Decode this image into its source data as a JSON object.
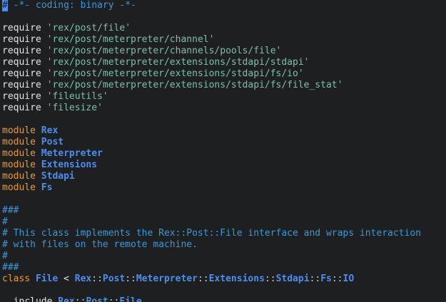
{
  "editor": {
    "lines": [
      [
        {
          "t": "#",
          "c": "cursor"
        },
        {
          "t": " -*- coding: binary -*-",
          "c": "comment"
        }
      ],
      [],
      [
        {
          "t": "require ",
          "c": "plain"
        },
        {
          "t": "'rex/post/file'",
          "c": "str"
        }
      ],
      [
        {
          "t": "require ",
          "c": "plain"
        },
        {
          "t": "'rex/post/meterpreter/channel'",
          "c": "str"
        }
      ],
      [
        {
          "t": "require ",
          "c": "plain"
        },
        {
          "t": "'rex/post/meterpreter/channels/pools/file'",
          "c": "str"
        }
      ],
      [
        {
          "t": "require ",
          "c": "plain"
        },
        {
          "t": "'rex/post/meterpreter/extensions/stdapi/stdapi'",
          "c": "str"
        }
      ],
      [
        {
          "t": "require ",
          "c": "plain"
        },
        {
          "t": "'rex/post/meterpreter/extensions/stdapi/fs/io'",
          "c": "str"
        }
      ],
      [
        {
          "t": "require ",
          "c": "plain"
        },
        {
          "t": "'rex/post/meterpreter/extensions/stdapi/fs/file_stat'",
          "c": "str"
        }
      ],
      [
        {
          "t": "require ",
          "c": "plain"
        },
        {
          "t": "'fileutils'",
          "c": "str"
        }
      ],
      [
        {
          "t": "require ",
          "c": "plain"
        },
        {
          "t": "'filesize'",
          "c": "str"
        }
      ],
      [],
      [
        {
          "t": "module ",
          "c": "kw"
        },
        {
          "t": "Rex",
          "c": "const"
        }
      ],
      [
        {
          "t": "module ",
          "c": "kw"
        },
        {
          "t": "Post",
          "c": "const"
        }
      ],
      [
        {
          "t": "module ",
          "c": "kw"
        },
        {
          "t": "Meterpreter",
          "c": "const"
        }
      ],
      [
        {
          "t": "module ",
          "c": "kw"
        },
        {
          "t": "Extensions",
          "c": "const"
        }
      ],
      [
        {
          "t": "module ",
          "c": "kw"
        },
        {
          "t": "Stdapi",
          "c": "const"
        }
      ],
      [
        {
          "t": "module ",
          "c": "kw"
        },
        {
          "t": "Fs",
          "c": "const"
        }
      ],
      [],
      [
        {
          "t": "###",
          "c": "comment"
        }
      ],
      [
        {
          "t": "#",
          "c": "comment"
        }
      ],
      [
        {
          "t": "# This class implements the Rex::Post::File interface and wraps interaction",
          "c": "comment"
        }
      ],
      [
        {
          "t": "# with files on the remote machine.",
          "c": "comment"
        }
      ],
      [
        {
          "t": "#",
          "c": "comment"
        }
      ],
      [
        {
          "t": "###",
          "c": "comment"
        }
      ],
      [
        {
          "t": "class ",
          "c": "kw"
        },
        {
          "t": "File",
          "c": "const"
        },
        {
          "t": " < ",
          "c": "plain"
        },
        {
          "t": "Rex",
          "c": "const"
        },
        {
          "t": "::",
          "c": "sep"
        },
        {
          "t": "Post",
          "c": "const"
        },
        {
          "t": "::",
          "c": "sep"
        },
        {
          "t": "Meterpreter",
          "c": "const"
        },
        {
          "t": "::",
          "c": "sep"
        },
        {
          "t": "Extensions",
          "c": "const"
        },
        {
          "t": "::",
          "c": "sep"
        },
        {
          "t": "Stdapi",
          "c": "const"
        },
        {
          "t": "::",
          "c": "sep"
        },
        {
          "t": "Fs",
          "c": "const"
        },
        {
          "t": "::",
          "c": "sep"
        },
        {
          "t": "IO",
          "c": "const"
        }
      ],
      [],
      [
        {
          "t": "  include ",
          "c": "plain"
        },
        {
          "t": "Rex",
          "c": "const"
        },
        {
          "t": "::",
          "c": "sep"
        },
        {
          "t": "Post",
          "c": "const"
        },
        {
          "t": "::",
          "c": "sep"
        },
        {
          "t": "File",
          "c": "const"
        }
      ]
    ]
  }
}
